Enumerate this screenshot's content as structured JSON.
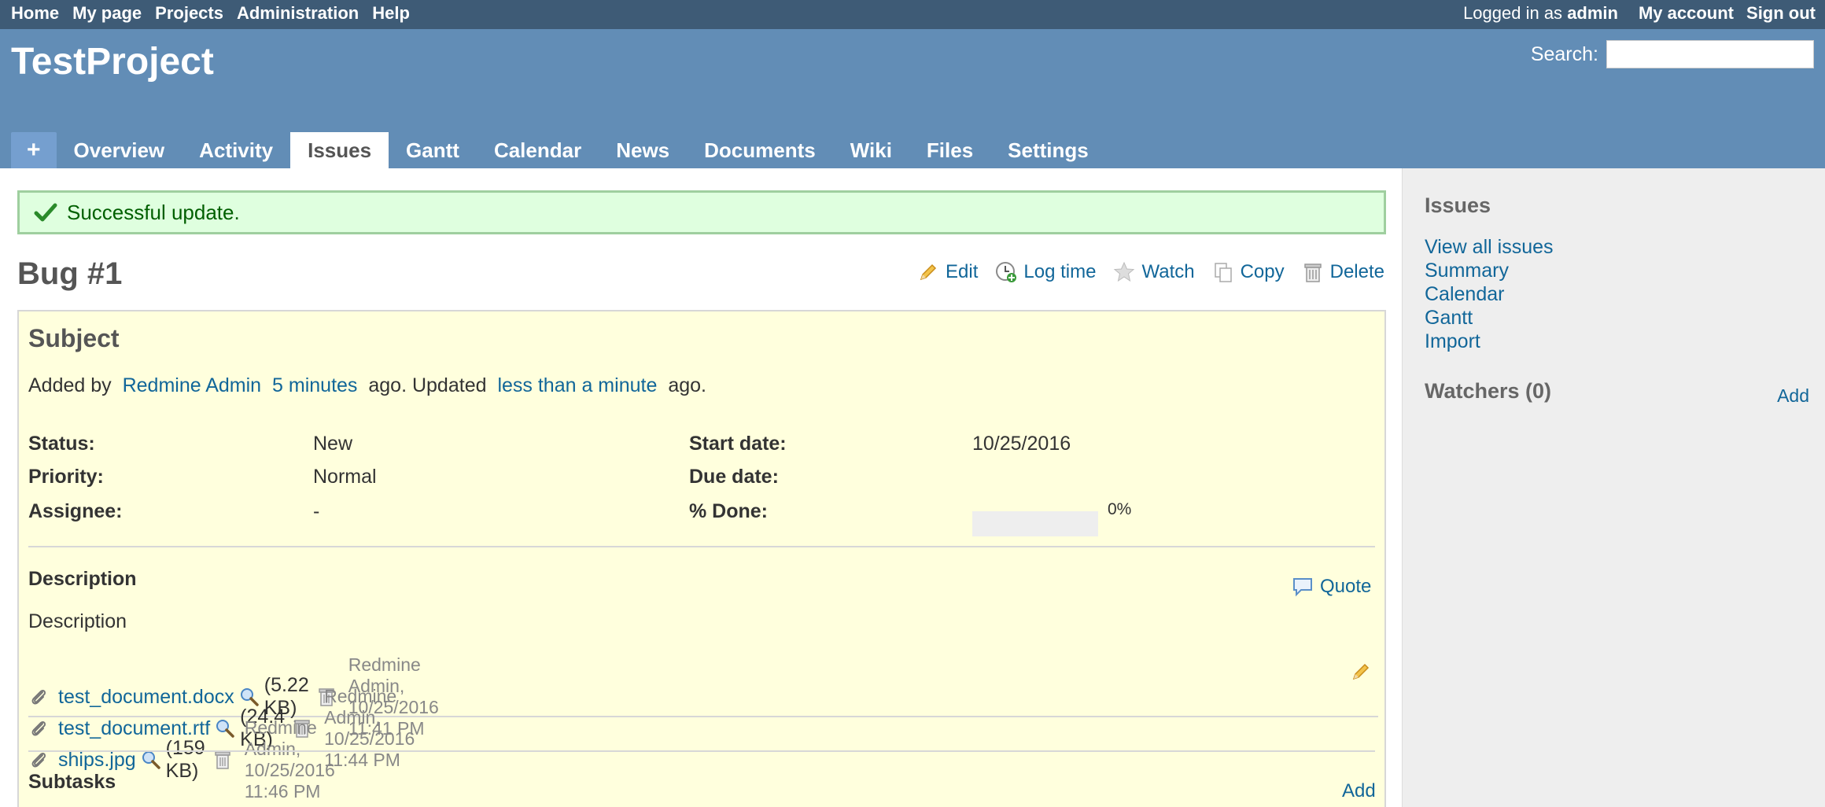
{
  "top_menu": {
    "items": [
      "Home",
      "My page",
      "Projects",
      "Administration",
      "Help"
    ],
    "logged_prefix": "Logged in as",
    "logged_user": "admin",
    "my_account": "My account",
    "sign_out": "Sign out"
  },
  "header": {
    "project_title": "TestProject",
    "search_label": "Search:",
    "search_value": ""
  },
  "tabs": {
    "new": "+",
    "items": [
      "Overview",
      "Activity",
      "Issues",
      "Gantt",
      "Calendar",
      "News",
      "Documents",
      "Wiki",
      "Files",
      "Settings"
    ],
    "selected": "Issues"
  },
  "flash": {
    "message": "Successful update."
  },
  "issue": {
    "title": "Bug #1",
    "actions": {
      "edit": "Edit",
      "log_time": "Log time",
      "watch": "Watch",
      "copy": "Copy",
      "delete": "Delete"
    },
    "subject": "Subject",
    "author": {
      "prefix": "Added by",
      "user": "Redmine Admin",
      "created": "5 minutes",
      "mid": "ago. Updated",
      "updated": "less than a minute",
      "suffix": "ago."
    },
    "attributes": {
      "status_label": "Status:",
      "status_value": "New",
      "priority_label": "Priority:",
      "priority_value": "Normal",
      "assignee_label": "Assignee:",
      "assignee_value": "-",
      "start_label": "Start date:",
      "start_value": "10/25/2016",
      "due_label": "Due date:",
      "due_value": "",
      "done_label": "% Done:",
      "done_value": "0%",
      "done_fraction": 0
    },
    "description_heading": "Description",
    "quote": "Quote",
    "description_text": "Description",
    "attachments": [
      {
        "name": "test_document.docx",
        "size": "(5.22 KB)",
        "meta": "Redmine Admin, 10/25/2016 11:41 PM"
      },
      {
        "name": "test_document.rtf",
        "size": "(24.4 KB)",
        "meta": "Redmine Admin, 10/25/2016 11:44 PM"
      },
      {
        "name": "ships.jpg",
        "size": "(159 KB)",
        "meta": "Redmine Admin, 10/25/2016 11:46 PM"
      }
    ],
    "subtasks_heading": "Subtasks",
    "subtasks_add": "Add"
  },
  "sidebar": {
    "issues_heading": "Issues",
    "links": [
      "View all issues",
      "Summary",
      "Calendar",
      "Gantt",
      "Import"
    ],
    "watchers_heading": "Watchers (0)",
    "watchers_add": "Add"
  },
  "colors": {
    "top_bar": "#3e5b76",
    "header": "#628db6",
    "link": "#116699",
    "issue_bg": "#ffffdd",
    "flash_bg": "#dfffdf"
  }
}
